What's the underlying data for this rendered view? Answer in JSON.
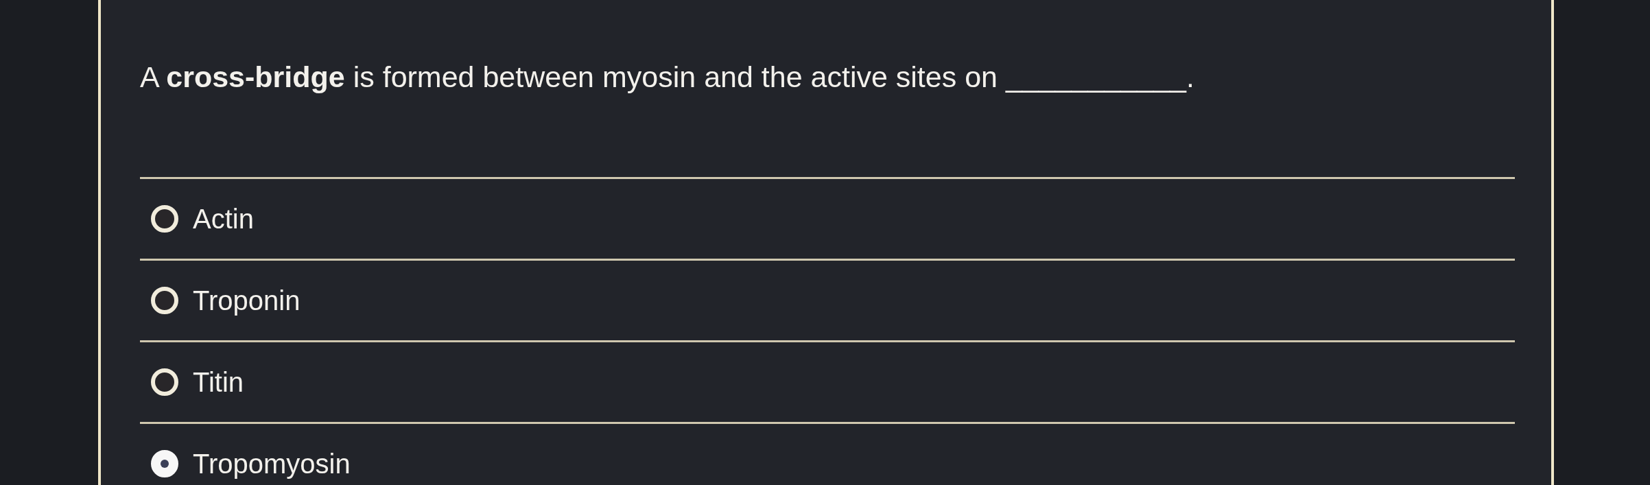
{
  "question": {
    "text": "A **cross-bridge** is formed between myosin and the active sites on ___________."
  },
  "options": [
    {
      "label": "Actin",
      "selected": false
    },
    {
      "label": "Troponin",
      "selected": false
    },
    {
      "label": "Titin",
      "selected": false
    },
    {
      "label": "Tropomyosin",
      "selected": true
    }
  ]
}
